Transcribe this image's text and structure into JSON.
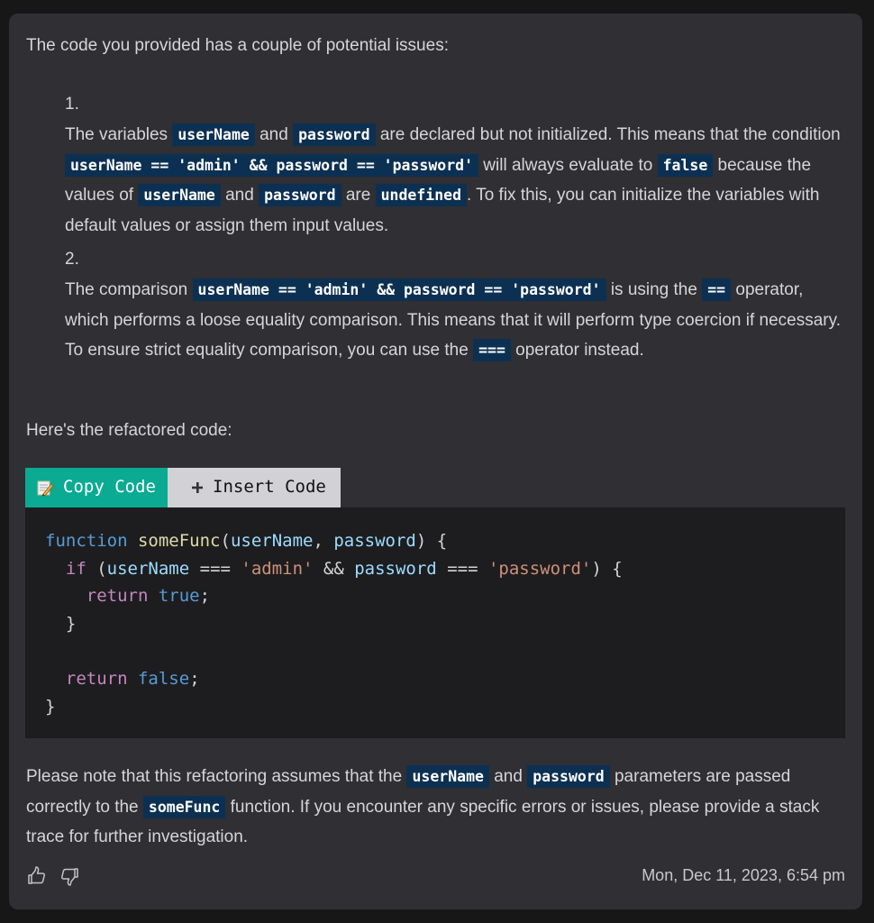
{
  "message": {
    "intro": "The code you provided has a couple of potential issues:",
    "issues": [
      {
        "number": "1.",
        "parts": [
          {
            "t": "text",
            "v": "The variables "
          },
          {
            "t": "code",
            "v": "userName"
          },
          {
            "t": "text",
            "v": " and "
          },
          {
            "t": "code",
            "v": "password"
          },
          {
            "t": "text",
            "v": " are declared but not initialized. This means that the condition "
          },
          {
            "t": "code",
            "v": "userName == 'admin' && password == 'password'"
          },
          {
            "t": "text",
            "v": " will always evaluate to "
          },
          {
            "t": "code",
            "v": "false"
          },
          {
            "t": "text",
            "v": " because the values of "
          },
          {
            "t": "code",
            "v": "userName"
          },
          {
            "t": "text",
            "v": " and "
          },
          {
            "t": "code",
            "v": "password"
          },
          {
            "t": "text",
            "v": " are "
          },
          {
            "t": "code",
            "v": "undefined"
          },
          {
            "t": "text",
            "v": ". To fix this, you can initialize the variables with default values or assign them input values."
          }
        ]
      },
      {
        "number": "2.",
        "parts": [
          {
            "t": "text",
            "v": "The comparison "
          },
          {
            "t": "code",
            "v": "userName == 'admin' && password == 'password'"
          },
          {
            "t": "text",
            "v": " is using the "
          },
          {
            "t": "code",
            "v": "=="
          },
          {
            "t": "text",
            "v": " operator, which performs a loose equality comparison. This means that it will perform type coercion if necessary. To ensure strict equality comparison, you can use the "
          },
          {
            "t": "code",
            "v": "==="
          },
          {
            "t": "text",
            "v": " operator instead."
          }
        ]
      }
    ],
    "refactored_label": "Here's the refactored code:",
    "code_toolbar": {
      "copy_label": "Copy Code",
      "copy_icon": "memo-pencil-icon",
      "insert_label": "Insert Code",
      "insert_icon": "plus-icon"
    },
    "code_lines": [
      [
        {
          "c": "k-fn",
          "v": "function"
        },
        {
          "c": "k-pun",
          "v": " "
        },
        {
          "c": "k-name",
          "v": "someFunc"
        },
        {
          "c": "k-pun",
          "v": "("
        },
        {
          "c": "k-var",
          "v": "userName"
        },
        {
          "c": "k-pun",
          "v": ", "
        },
        {
          "c": "k-var",
          "v": "password"
        },
        {
          "c": "k-pun",
          "v": ") {"
        }
      ],
      [
        {
          "c": "k-pun",
          "v": "  "
        },
        {
          "c": "k-ctl",
          "v": "if"
        },
        {
          "c": "k-pun",
          "v": " ("
        },
        {
          "c": "k-var",
          "v": "userName"
        },
        {
          "c": "k-pun",
          "v": " === "
        },
        {
          "c": "k-str",
          "v": "'admin'"
        },
        {
          "c": "k-pun",
          "v": " && "
        },
        {
          "c": "k-var",
          "v": "password"
        },
        {
          "c": "k-pun",
          "v": " === "
        },
        {
          "c": "k-str",
          "v": "'password'"
        },
        {
          "c": "k-pun",
          "v": ") {"
        }
      ],
      [
        {
          "c": "k-pun",
          "v": "    "
        },
        {
          "c": "k-ctl",
          "v": "return"
        },
        {
          "c": "k-pun",
          "v": " "
        },
        {
          "c": "k-bool",
          "v": "true"
        },
        {
          "c": "k-pun",
          "v": ";"
        }
      ],
      [
        {
          "c": "k-pun",
          "v": "  }"
        }
      ],
      [
        {
          "c": "k-pun",
          "v": ""
        }
      ],
      [
        {
          "c": "k-pun",
          "v": "  "
        },
        {
          "c": "k-ctl",
          "v": "return"
        },
        {
          "c": "k-pun",
          "v": " "
        },
        {
          "c": "k-bool",
          "v": "false"
        },
        {
          "c": "k-pun",
          "v": ";"
        }
      ],
      [
        {
          "c": "k-pun",
          "v": "}"
        }
      ]
    ],
    "outro_parts": [
      {
        "t": "text",
        "v": "Please note that this refactoring assumes that the "
      },
      {
        "t": "code",
        "v": "userName"
      },
      {
        "t": "text",
        "v": " and "
      },
      {
        "t": "code",
        "v": "password"
      },
      {
        "t": "text",
        "v": " parameters are passed correctly to the "
      },
      {
        "t": "code",
        "v": "someFunc"
      },
      {
        "t": "text",
        "v": " function. If you encounter any specific errors or issues, please provide a stack trace for further investigation."
      }
    ],
    "footer": {
      "thumbs_up_icon": "thumbs-up-icon",
      "thumbs_down_icon": "thumbs-down-icon",
      "timestamp": "Mon, Dec 11, 2023, 6:54 pm"
    }
  },
  "colors": {
    "page_bg": "#171717",
    "card_bg": "#2f2f34",
    "inline_code_bg": "#0c3052",
    "copy_button_bg": "#0aab92",
    "insert_button_bg": "#d1d1d6",
    "code_block_bg": "#1d1d1f"
  }
}
